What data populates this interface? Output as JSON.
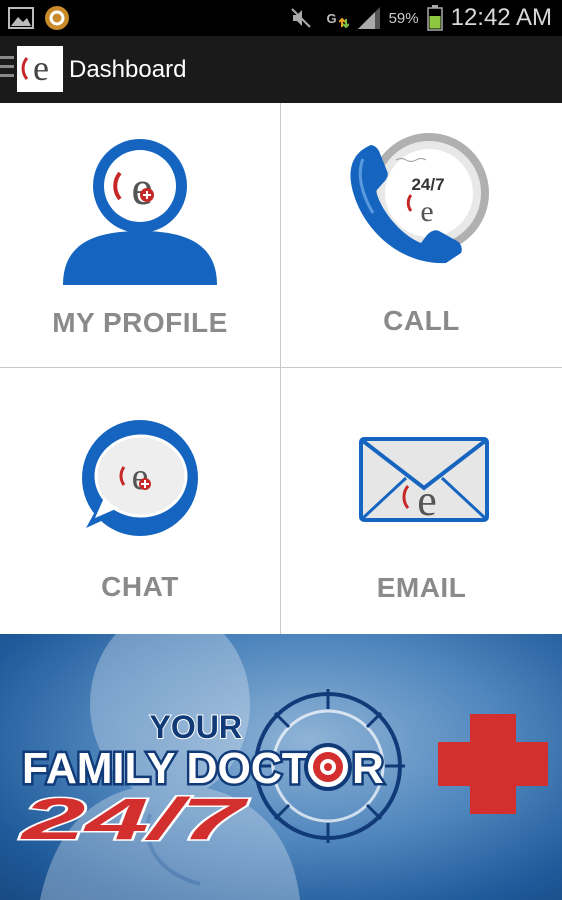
{
  "status_bar": {
    "battery_percent": "59%",
    "clock": "12:42 AM",
    "network_type": "G",
    "icons": [
      "gallery-icon",
      "app-notification-icon",
      "mute-icon",
      "data-arrows-icon",
      "signal-icon",
      "battery-icon"
    ]
  },
  "action_bar": {
    "title": "Dashboard",
    "logo_letter": "e"
  },
  "tiles": [
    {
      "label": "MY PROFILE",
      "icon": "profile-icon"
    },
    {
      "label": "CALL",
      "icon": "phone-icon",
      "badge": "24/7"
    },
    {
      "label": "CHAT",
      "icon": "chat-bubble-icon"
    },
    {
      "label": "EMAIL",
      "icon": "envelope-icon"
    }
  ],
  "banner": {
    "line1": "YOUR",
    "line2_a": "FAMILY DOCT",
    "line2_b": "R",
    "line3": "24/7",
    "icon": "red-cross-icon"
  },
  "colors": {
    "brand_blue": "#1565c0",
    "brand_red": "#d32f2f",
    "label_gray": "#8a8a8a",
    "action_bar": "#1a1a1a"
  }
}
